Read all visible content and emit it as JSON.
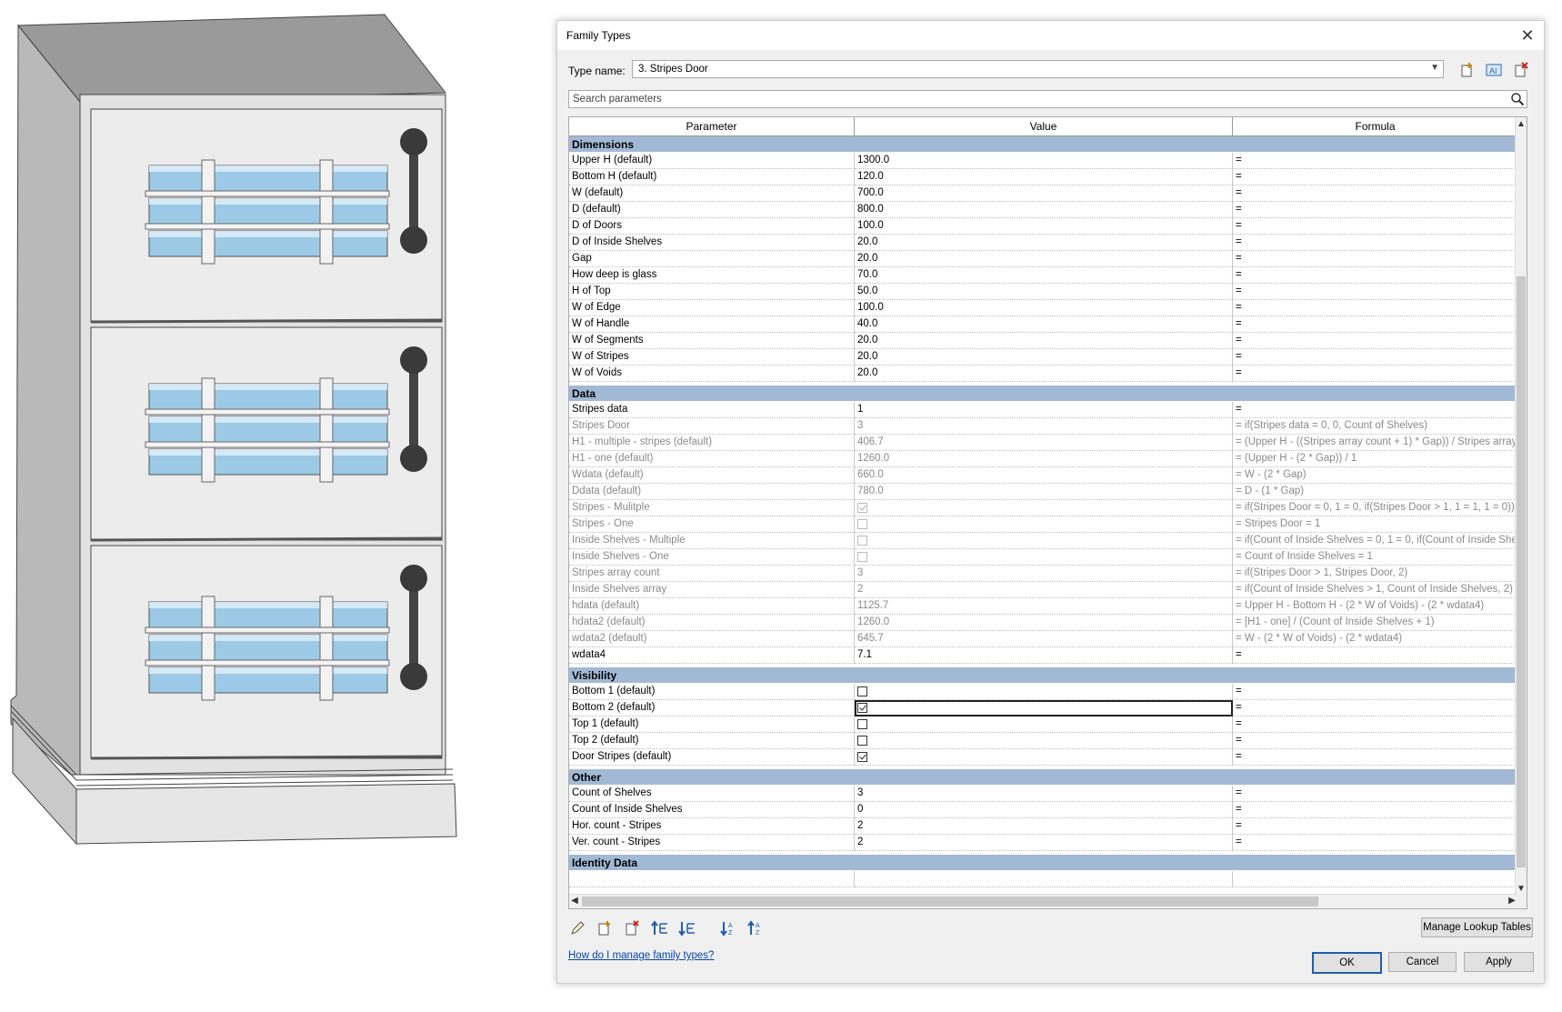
{
  "dialog": {
    "title": "Family Types",
    "type_name_label": "Type name:",
    "type_name_value": "3. Stripes Door",
    "search_placeholder": "Search parameters",
    "columns": [
      "Parameter",
      "Value",
      "Formula"
    ],
    "help_link": "How do I manage family types?",
    "manage_lookup_label": "Manage Lookup Tables",
    "ok_label": "OK",
    "cancel_label": "Cancel",
    "apply_label": "Apply"
  },
  "groups": [
    {
      "name": "Dimensions",
      "rows": [
        {
          "param": "Upper H (default)",
          "value": "1300.0",
          "formula": "=",
          "ro": false
        },
        {
          "param": "Bottom H (default)",
          "value": "120.0",
          "formula": "=",
          "ro": false
        },
        {
          "param": "W (default)",
          "value": "700.0",
          "formula": "=",
          "ro": false
        },
        {
          "param": "D (default)",
          "value": "800.0",
          "formula": "=",
          "ro": false
        },
        {
          "param": "D of Doors",
          "value": "100.0",
          "formula": "=",
          "ro": false
        },
        {
          "param": "D of Inside Shelves",
          "value": "20.0",
          "formula": "=",
          "ro": false
        },
        {
          "param": "Gap",
          "value": "20.0",
          "formula": "=",
          "ro": false
        },
        {
          "param": "How deep is glass",
          "value": "70.0",
          "formula": "=",
          "ro": false
        },
        {
          "param": "H of Top",
          "value": "50.0",
          "formula": "=",
          "ro": false
        },
        {
          "param": "W of Edge",
          "value": "100.0",
          "formula": "=",
          "ro": false
        },
        {
          "param": "W of Handle",
          "value": "40.0",
          "formula": "=",
          "ro": false
        },
        {
          "param": "W of Segments",
          "value": "20.0",
          "formula": "=",
          "ro": false
        },
        {
          "param": "W of Stripes",
          "value": "20.0",
          "formula": "=",
          "ro": false
        },
        {
          "param": "W of Voids",
          "value": "20.0",
          "formula": "=",
          "ro": false
        }
      ]
    },
    {
      "name": "Data",
      "rows": [
        {
          "param": "Stripes data",
          "value": "1",
          "formula": "=",
          "ro": false
        },
        {
          "param": "Stripes Door",
          "value": "3",
          "formula": "= if(Stripes data = 0, 0, Count of Shelves)",
          "ro": true
        },
        {
          "param": "H1 - multiple - stripes (default)",
          "value": "406.7",
          "formula": "= (Upper H - ((Stripes array count + 1) * Gap)) / Stripes array",
          "ro": true
        },
        {
          "param": "H1 - one (default)",
          "value": "1260.0",
          "formula": "= (Upper H - (2 * Gap)) / 1",
          "ro": true
        },
        {
          "param": "Wdata (default)",
          "value": "660.0",
          "formula": "= W - (2 * Gap)",
          "ro": true
        },
        {
          "param": "Ddata (default)",
          "value": "780.0",
          "formula": "= D - (1 * Gap)",
          "ro": true
        },
        {
          "param": "Stripes - Mulitple",
          "check": true,
          "formula": "= if(Stripes Door = 0, 1 = 0, if(Stripes Door > 1, 1 = 1, 1 = 0))",
          "ro": true
        },
        {
          "param": "Stripes - One",
          "check": false,
          "formula": "= Stripes Door = 1",
          "ro": true
        },
        {
          "param": "Inside Shelves - Multiple",
          "check": false,
          "formula": "= if(Count of Inside Shelves = 0, 1 = 0, if(Count of Inside She",
          "ro": true
        },
        {
          "param": "Inside Shelves - One",
          "check": false,
          "formula": "= Count of Inside Shelves = 1",
          "ro": true
        },
        {
          "param": "Stripes array count",
          "value": "3",
          "formula": "= if(Stripes Door > 1, Stripes Door, 2)",
          "ro": true
        },
        {
          "param": "Inside Shelves array",
          "value": "2",
          "formula": "= if(Count of Inside Shelves > 1, Count of Inside Shelves, 2)",
          "ro": true
        },
        {
          "param": "hdata (default)",
          "value": "1125.7",
          "formula": "= Upper H - Bottom H - (2 * W of Voids) - (2 * wdata4)",
          "ro": true
        },
        {
          "param": "hdata2 (default)",
          "value": "1260.0",
          "formula": "= [H1 - one] / (Count of Inside Shelves + 1)",
          "ro": true
        },
        {
          "param": "wdata2 (default)",
          "value": "645.7",
          "formula": "= W - (2 * W of Voids) - (2 * wdata4)",
          "ro": true
        },
        {
          "param": "wdata4",
          "value": "7.1",
          "formula": "=",
          "ro": false
        }
      ]
    },
    {
      "name": "Visibility",
      "rows": [
        {
          "param": "Bottom 1 (default)",
          "check": false,
          "formula": "=",
          "ro": false
        },
        {
          "param": "Bottom 2 (default)",
          "check": true,
          "formula": "=",
          "ro": false,
          "focused": true
        },
        {
          "param": "Top 1 (default)",
          "check": false,
          "formula": "=",
          "ro": false
        },
        {
          "param": "Top 2 (default)",
          "check": false,
          "formula": "=",
          "ro": false
        },
        {
          "param": "Door Stripes (default)",
          "check": true,
          "formula": "=",
          "ro": false
        }
      ]
    },
    {
      "name": "Other",
      "rows": [
        {
          "param": "Count of Shelves",
          "value": "3",
          "formula": "=",
          "ro": false
        },
        {
          "param": "Count of Inside Shelves",
          "value": "0",
          "formula": "=",
          "ro": false
        },
        {
          "param": "Hor. count - Stripes",
          "value": "2",
          "formula": "=",
          "ro": false
        },
        {
          "param": "Ver. count - Stripes",
          "value": "2",
          "formula": "=",
          "ro": false
        }
      ]
    },
    {
      "name": "Identity Data",
      "rows": [
        {
          "param": "",
          "value": "",
          "formula": "",
          "ro": false
        }
      ]
    }
  ],
  "icons": {
    "toolbar": [
      "new-type-icon",
      "rename-type-icon",
      "delete-type-icon"
    ],
    "search": "magnifier-icon",
    "bottom_tools": [
      "edit-parameter-icon",
      "new-parameter-icon",
      "delete-parameter-icon",
      "move-up-icon",
      "move-down-icon",
      "sort-ascending-icon",
      "sort-descending-icon"
    ]
  },
  "colors": {
    "group_header": "#a2b9d5",
    "glass": "#9cc9e6",
    "cabinet_panel": "#ececec",
    "link": "#0645ad"
  }
}
